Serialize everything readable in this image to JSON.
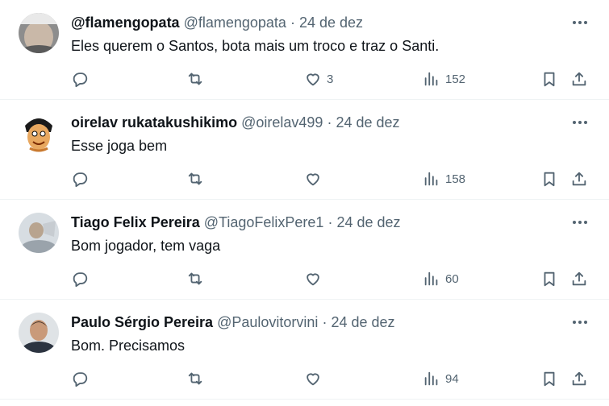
{
  "tweets": [
    {
      "name": "@flamengopata",
      "handle": "@flamengopata",
      "sep": "·",
      "date": "24 de dez",
      "text": "Eles querem o Santos, bota mais um troco e traz o Santi.",
      "likes": "3",
      "views": "152"
    },
    {
      "name": "oirelav rukatakushikimo",
      "handle": "@oirelav499",
      "sep": "·",
      "date": "24 de dez",
      "text": "Esse joga bem",
      "likes": "",
      "views": "158"
    },
    {
      "name": "Tiago Felix Pereira",
      "handle": "@TiagoFelixPere1",
      "sep": "·",
      "date": "24 de dez",
      "text": "Bom jogador, tem vaga",
      "likes": "",
      "views": "60"
    },
    {
      "name": "Paulo Sérgio Pereira",
      "handle": "@Paulovitorvini",
      "sep": "·",
      "date": "24 de dez",
      "text": "Bom. Precisamos",
      "likes": "",
      "views": "94"
    }
  ],
  "icons": {
    "more": "more-dots-icon",
    "reply": "reply-icon",
    "retweet": "retweet-icon",
    "like": "heart-icon",
    "views": "views-chart-icon",
    "bookmark": "bookmark-icon",
    "share": "share-icon"
  },
  "colors": {
    "text": "#0f1419",
    "secondary": "#536471",
    "divider": "#eff3f4"
  }
}
